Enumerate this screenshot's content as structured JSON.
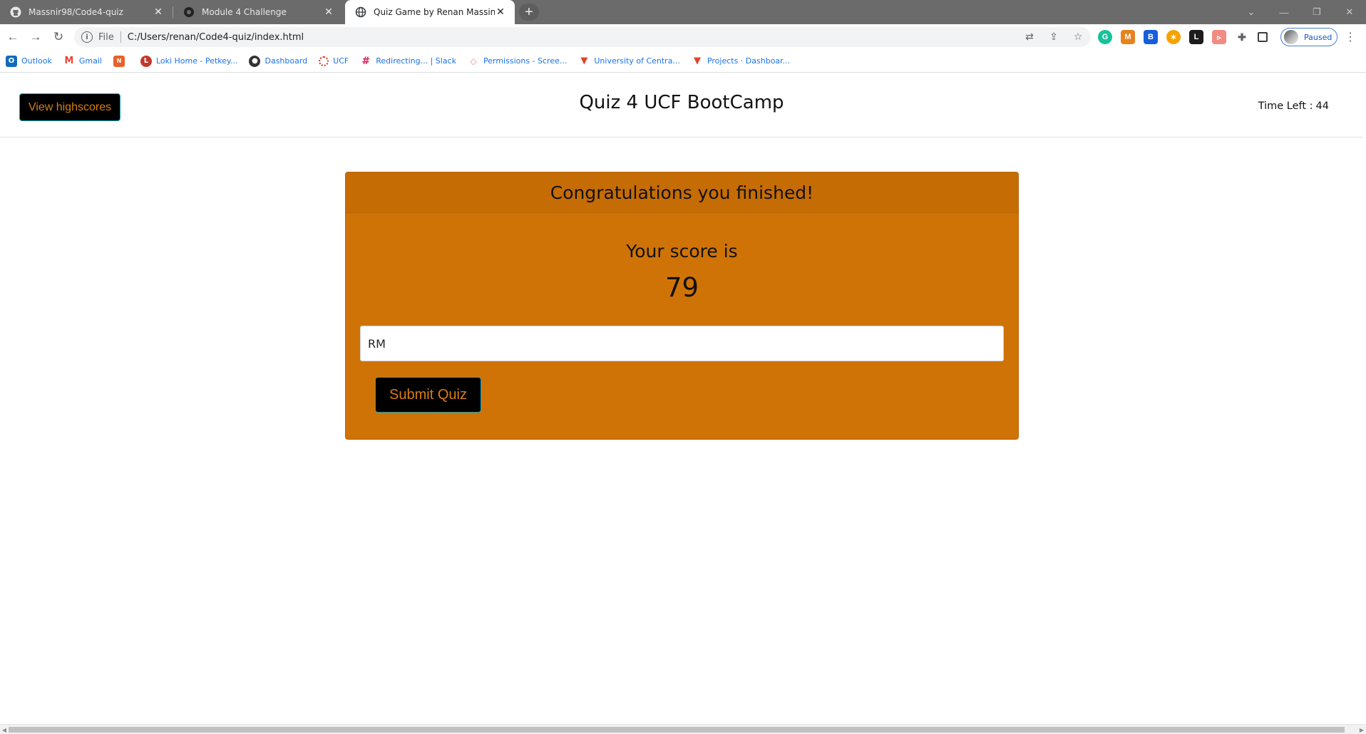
{
  "browser": {
    "tabs": [
      {
        "title": "Massnir98/Code4-quiz",
        "icon": "github-icon",
        "active": false
      },
      {
        "title": "Module 4 Challenge",
        "icon": "canvas-icon",
        "active": false
      },
      {
        "title": "Quiz Game by Renan Massini",
        "icon": "globe-icon",
        "active": true
      }
    ],
    "address": {
      "scheme_label": "File",
      "url": "C:/Users/renan/Code4-quiz/index.html"
    },
    "profile_status": "Paused",
    "bookmarks": [
      {
        "label": "Outlook",
        "icon": "outlook-icon",
        "color": "#0f6cbd"
      },
      {
        "label": "Gmail",
        "icon": "gmail-icon",
        "color": "#ea4335"
      },
      {
        "label": "",
        "icon": "ninja-icon",
        "color": "#e8622a"
      },
      {
        "label": "Loki Home - Petkey...",
        "icon": "loki-icon",
        "color": "#c0392b"
      },
      {
        "label": "Dashboard",
        "icon": "canvas-icon",
        "color": "#333333"
      },
      {
        "label": "UCF",
        "icon": "ucf-icon",
        "color": "#d33b2c"
      },
      {
        "label": "Redirecting... | Slack",
        "icon": "slack-icon",
        "color": "#4a154b"
      },
      {
        "label": "Permissions - Scree...",
        "icon": "permissions-icon",
        "color": "#f28b82"
      },
      {
        "label": "University of Centra...",
        "icon": "gitlab-icon",
        "color": "#e24329"
      },
      {
        "label": "Projects · Dashboar...",
        "icon": "gitlab-icon",
        "color": "#e24329"
      }
    ]
  },
  "page": {
    "header": {
      "highscores_button": "View highscores",
      "title": "Quiz 4 UCF BootCamp",
      "timer_label": "Time Left :",
      "timer_value": "44"
    },
    "card": {
      "heading": "Congratulations you finished!",
      "score_label": "Your score is",
      "score_value": "79",
      "initials_value": "RM",
      "submit_button": "Submit Quiz"
    }
  },
  "colors": {
    "card_background": "#d07306",
    "button_text": "#d97d10",
    "button_border": "#17a2b8"
  }
}
